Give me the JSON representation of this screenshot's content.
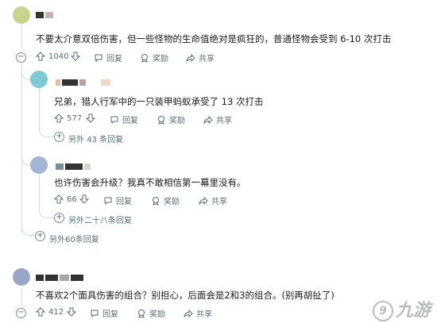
{
  "comments": [
    {
      "text": "不要太介意双倍伤害，但一些怪物的生命值绝对是疯狂的，普通怪物会受到 6-10 次打击",
      "votes": "1040",
      "reply_label": "回复",
      "award_label": "奖励",
      "share_label": "共享"
    },
    {
      "text": "兄弟，猎人行军中的一只装甲蚂蚁承受了 13 次打击",
      "votes": "577",
      "reply_label": "回复",
      "award_label": "奖励",
      "share_label": "共享",
      "more_replies": "另外 43 条回复"
    },
    {
      "text": "也许伤害会升级？我真不敢相信第一幕里没有。",
      "votes": "66",
      "reply_label": "回复",
      "award_label": "奖励",
      "share_label": "共享",
      "more_replies": "另外二十八条回复"
    },
    {
      "text": "不喜欢2个面具伤害的组合？别担心，后面会是2和3的组合。(别再胡扯了)",
      "votes": "412",
      "reply_label": "回复",
      "award_label": "奖励",
      "share_label": "共享"
    }
  ],
  "thread_more_replies": "另外60条回复",
  "collapse_symbol": "−",
  "expand_symbol": "+",
  "watermark": "九游",
  "colors": {
    "text": "#1a1a1b",
    "meta": "#576f76",
    "line": "#d6dadc"
  }
}
